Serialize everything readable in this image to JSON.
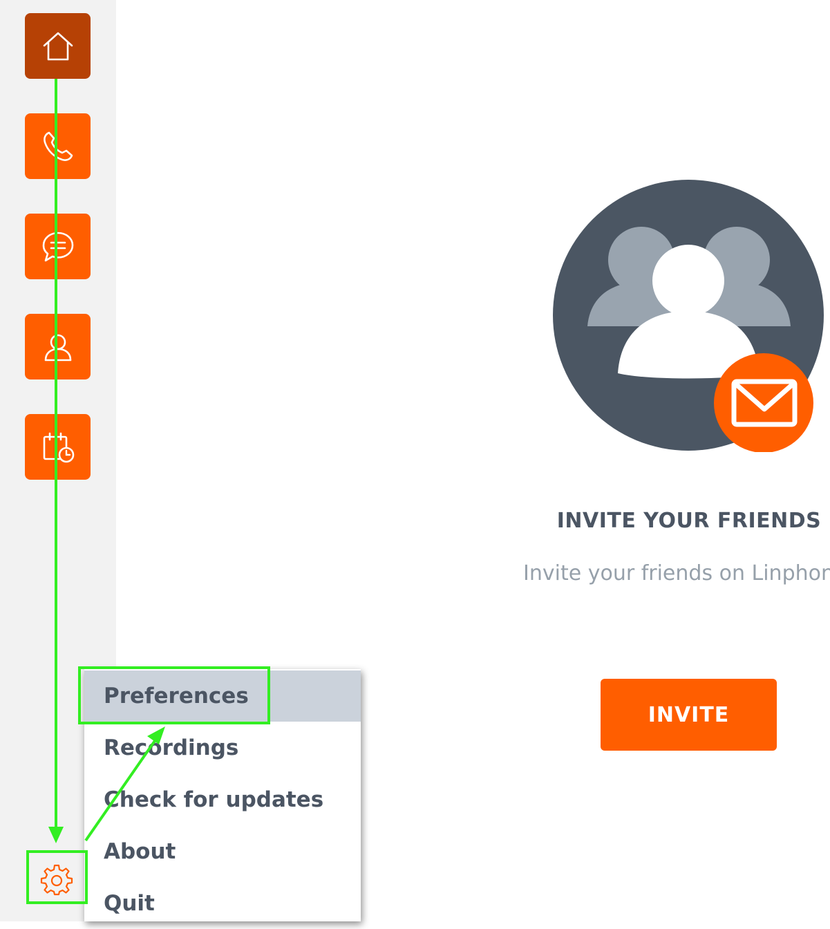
{
  "sidebar": {
    "items": [
      {
        "name": "home",
        "icon": "house-icon",
        "active": true
      },
      {
        "name": "calls",
        "icon": "phone-icon"
      },
      {
        "name": "chat",
        "icon": "chat-bubble-icon"
      },
      {
        "name": "contacts",
        "icon": "person-icon"
      },
      {
        "name": "meetings",
        "icon": "calendar-clock-icon"
      }
    ],
    "settings_icon": "gear-icon"
  },
  "settings_menu": {
    "items": [
      {
        "label": "Preferences",
        "highlighted": true
      },
      {
        "label": "Recordings"
      },
      {
        "label": "Check for updates"
      },
      {
        "label": "About"
      },
      {
        "label": "Quit"
      }
    ]
  },
  "main": {
    "invite_title": "INVITE YOUR FRIENDS",
    "invite_subtitle": "Invite your friends on Linphone",
    "invite_button": "INVITE"
  },
  "colors": {
    "accent": "#ff5e00",
    "accent_active": "#b64105",
    "sidebar_bg": "#f2f2f2",
    "text": "#4b5563",
    "subtext": "#96a0aa",
    "highlight": "#cbd2db",
    "annotation": "#33ee22"
  }
}
